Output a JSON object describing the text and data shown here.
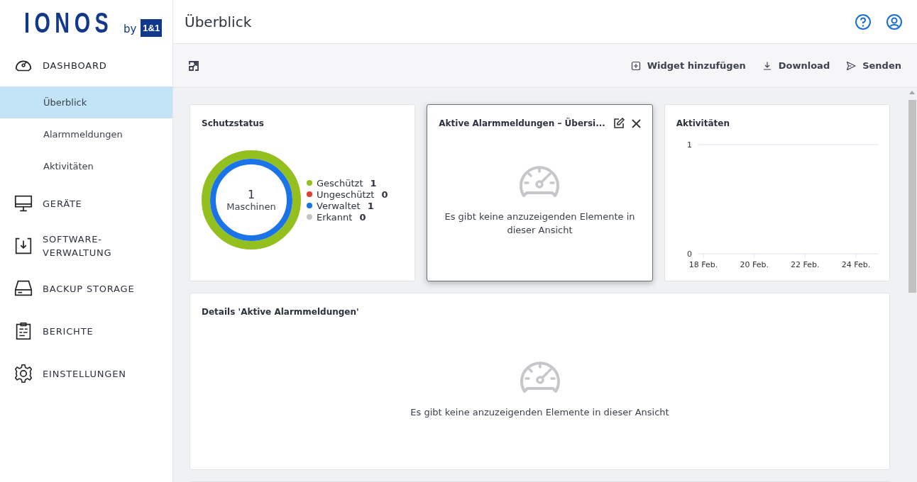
{
  "logo": {
    "brand": "IONOS",
    "by": "by",
    "badge": "1&1"
  },
  "sidebar": {
    "items": [
      {
        "label": "DASHBOARD",
        "expanded": true,
        "children": [
          {
            "label": "Überblick",
            "selected": true
          },
          {
            "label": "Alarmmeldungen",
            "selected": false
          },
          {
            "label": "Aktivitäten",
            "selected": false
          }
        ]
      },
      {
        "label": "GERÄTE",
        "expanded": false
      },
      {
        "label": "SOFTWARE-\nVERWALTUNG",
        "expanded": false
      },
      {
        "label": "BACKUP STORAGE",
        "expanded": false
      },
      {
        "label": "BERICHTE",
        "expanded": false
      },
      {
        "label": "EINSTELLUNGEN",
        "expanded": false
      }
    ]
  },
  "header": {
    "title": "Überblick"
  },
  "toolbar": {
    "actions": [
      {
        "label": "Widget hinzufügen"
      },
      {
        "label": "Download"
      },
      {
        "label": "Senden"
      }
    ]
  },
  "widgets": [
    {
      "kind": "donut",
      "title": "Schutzstatus",
      "total": "1",
      "total_label": "Maschinen",
      "legend": [
        {
          "label": "Geschützt",
          "count": "1",
          "color": "#93c01f"
        },
        {
          "label": "Ungeschützt",
          "count": "0",
          "color": "#e03c31"
        },
        {
          "label": "Verwaltet",
          "count": "1",
          "color": "#1a73e8"
        },
        {
          "label": "Erkannt",
          "count": "0",
          "color": "#c4c4c4"
        }
      ]
    },
    {
      "kind": "empty",
      "title": "Aktive Alarmmeldungen – Übersi...",
      "focused": true,
      "message": "Es gibt keine anzuzeigenden Elemente in dieser Ansicht"
    },
    {
      "kind": "chart",
      "title": "Aktivitäten",
      "chart_data": {
        "type": "line",
        "categories": [
          "18 Feb.",
          "20 Feb.",
          "22 Feb.",
          "24 Feb."
        ],
        "ylim": [
          0,
          1
        ],
        "yticks": [
          0,
          1
        ]
      }
    },
    {
      "kind": "details",
      "title": "Details 'Aktive Alarmmeldungen'",
      "focused": false,
      "message": "Es gibt keine anzuzeigenden Elemente in dieser Ansicht"
    }
  ]
}
